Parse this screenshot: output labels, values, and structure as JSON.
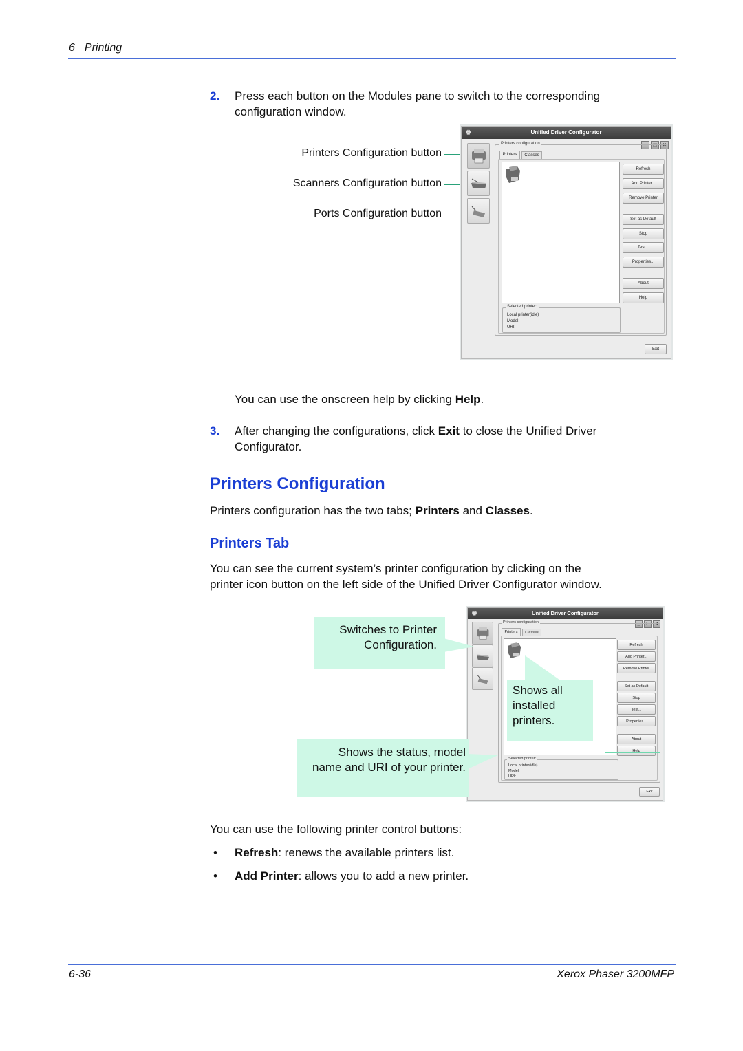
{
  "header": {
    "chapter_number": "6",
    "chapter_title": "Printing"
  },
  "step2": {
    "number": "2.",
    "text_line1": "Press each button on the Modules pane to switch to the corresponding",
    "text_line2": "configuration window."
  },
  "figure1": {
    "callouts": [
      "Printers Configuration button",
      "Scanners Configuration button",
      "Ports Configuration button"
    ]
  },
  "window": {
    "title": "Unified Driver Configurator",
    "app_icon": "printer-app-icon",
    "controls": {
      "minimize": "_",
      "maximize": "□",
      "close": "×"
    },
    "modules": [
      {
        "name": "printers-module",
        "icon": "printer-icon"
      },
      {
        "name": "scanners-module",
        "icon": "scanner-icon"
      },
      {
        "name": "ports-module",
        "icon": "port-icon"
      }
    ],
    "group_label": "Printers configuration",
    "tabs": [
      "Printers",
      "Classes"
    ],
    "active_tab": "Printers",
    "buttons": {
      "refresh": "Refresh",
      "add_printer": "Add Printer...",
      "remove_printer": "Remove Printer",
      "set_default": "Set as Default",
      "stop": "Stop",
      "test": "Test...",
      "properties": "Properties...",
      "about": "About",
      "help": "Help",
      "exit": "Exit"
    },
    "selected_printer": {
      "label": "Selected printer:",
      "status": "Local printer(idle)",
      "model": "Model:",
      "uri": "URI:"
    }
  },
  "help_note": {
    "prefix": "You can use the onscreen help by clicking ",
    "bold": "Help",
    "suffix": "."
  },
  "step3": {
    "number": "3.",
    "prefix": "After changing the configurations, click ",
    "bold": "Exit",
    "suffix_line1": " to close the Unified Driver",
    "line2": "Configurator."
  },
  "section": {
    "title": "Printers Configuration",
    "intro_prefix": "Printers configuration has the two tabs; ",
    "intro_bold1": "Printers",
    "intro_mid": " and ",
    "intro_bold2": "Classes",
    "intro_suffix": "."
  },
  "subsection": {
    "title": "Printers Tab",
    "text_line1": "You can see the current system’s printer configuration by clicking on the",
    "text_line2": "printer icon button on the left side of the Unified Driver Configurator window."
  },
  "figure2": {
    "callout_switch_line1": "Switches to Printer",
    "callout_switch_line2": "Configuration.",
    "callout_shows_line1": "Shows all",
    "callout_shows_line2": "installed",
    "callout_shows_line3": "printers.",
    "callout_status_line1": "Shows the status, model",
    "callout_status_line2": "name and URI of your printer."
  },
  "controls_intro": "You can use the following printer control buttons:",
  "bullets": [
    {
      "bold": "Refresh",
      "text": ": renews the available printers list."
    },
    {
      "bold": "Add Printer",
      "text": ": allows you to add a new printer."
    }
  ],
  "footer": {
    "page": "6-36",
    "product": "Xerox Phaser 3200MFP"
  },
  "colors": {
    "accent_blue": "#1a3ed4",
    "rule_blue": "#4a6fd8",
    "callout_mint": "#cef8e6",
    "callout_green": "#1e9a6a"
  }
}
